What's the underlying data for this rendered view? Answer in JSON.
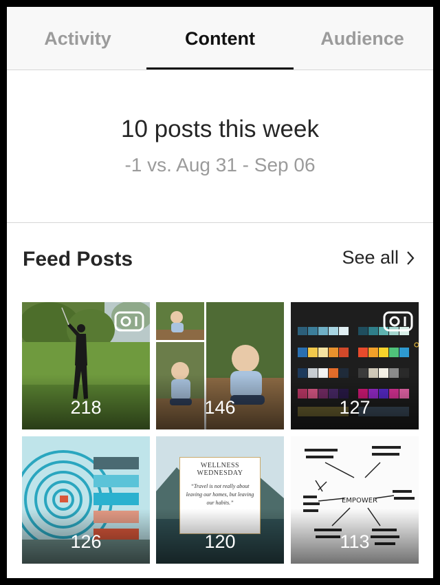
{
  "tabs": [
    {
      "label": "Activity",
      "active": false
    },
    {
      "label": "Content",
      "active": true
    },
    {
      "label": "Audience",
      "active": false
    }
  ],
  "summary": {
    "headline": "10 posts this week",
    "comparison": "-1 vs. Aug 31 - Sep 06"
  },
  "feed": {
    "title": "Feed Posts",
    "see_all_label": "See all",
    "posts": [
      {
        "count": "218",
        "video": true,
        "thumbnail": "woman playing golf on lawn"
      },
      {
        "count": "146",
        "video": false,
        "thumbnail": "collage of baby sitting on bench"
      },
      {
        "count": "127",
        "video": true,
        "thumbnail": "color theme palettes on dark screen"
      },
      {
        "count": "126",
        "video": false,
        "thumbnail": "abstract teal circles and stripes"
      },
      {
        "count": "120",
        "video": false,
        "thumbnail": "mountain lake quote card",
        "quote_title": "WELLNESS WEDNESDAY",
        "quote_text": "“Travel is not really about leaving our homes, but leaving our habits.”"
      },
      {
        "count": "113",
        "video": false,
        "thumbnail": "hand-drawn mind map",
        "center_word": "EMPOWER"
      }
    ]
  },
  "colors": {
    "active_tab": "#111111",
    "inactive_tab": "#9b9b9b",
    "divider": "#d6d6d6"
  }
}
